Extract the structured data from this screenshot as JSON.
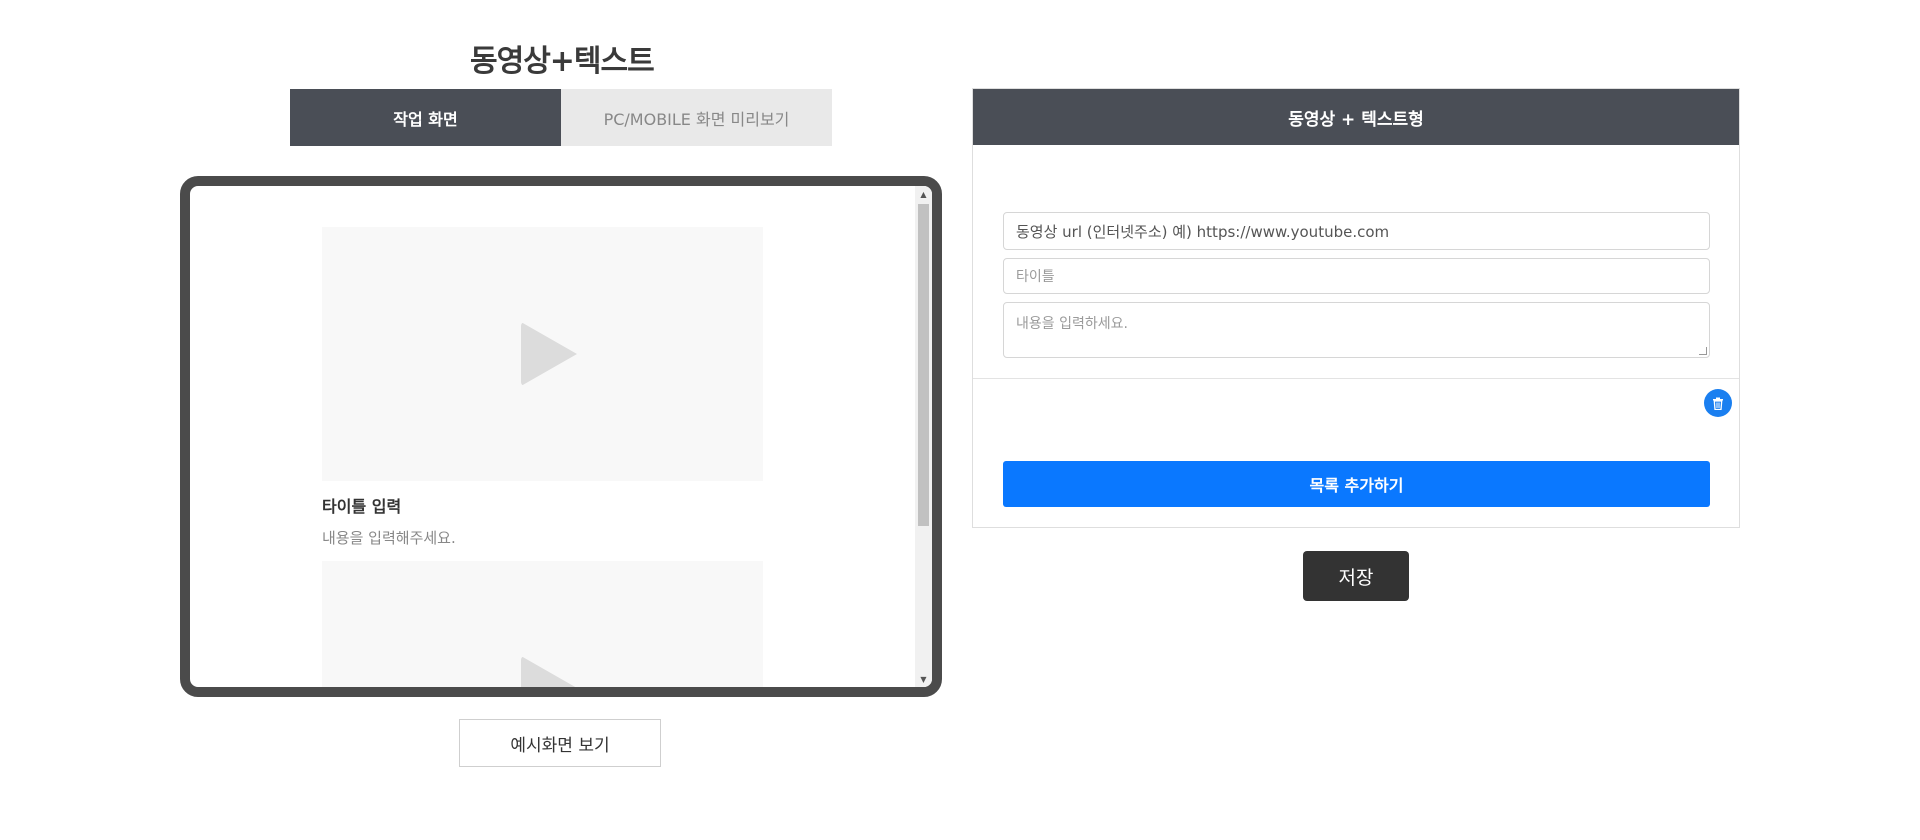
{
  "page": {
    "title": "동영상+텍스트"
  },
  "tabs": [
    {
      "label": "작업 화면",
      "active": true
    },
    {
      "label": "PC/MOBILE 화면 미리보기",
      "active": false
    }
  ],
  "preview": {
    "cards": [
      {
        "title": "타이틀 입력",
        "content": "내용을 입력해주세요.",
        "icon": "play-icon"
      },
      {
        "title": "",
        "content": "",
        "icon": "play-icon"
      }
    ],
    "example_button": "예시화면 보기"
  },
  "panel": {
    "header": "동영상 + 텍스트형",
    "url_field": {
      "value": "동영상 url (인터넷주소) 예) https://www.youtube.com"
    },
    "title_field": {
      "placeholder": "타이틀"
    },
    "content_field": {
      "placeholder": "내용을 입력하세요."
    },
    "delete_icon": "trash-icon",
    "add_button": "목록 추가하기"
  },
  "save_button": "저장",
  "colors": {
    "header_bg": "#4a4e56",
    "accent": "#0a78ff",
    "save_bg": "#333333"
  }
}
